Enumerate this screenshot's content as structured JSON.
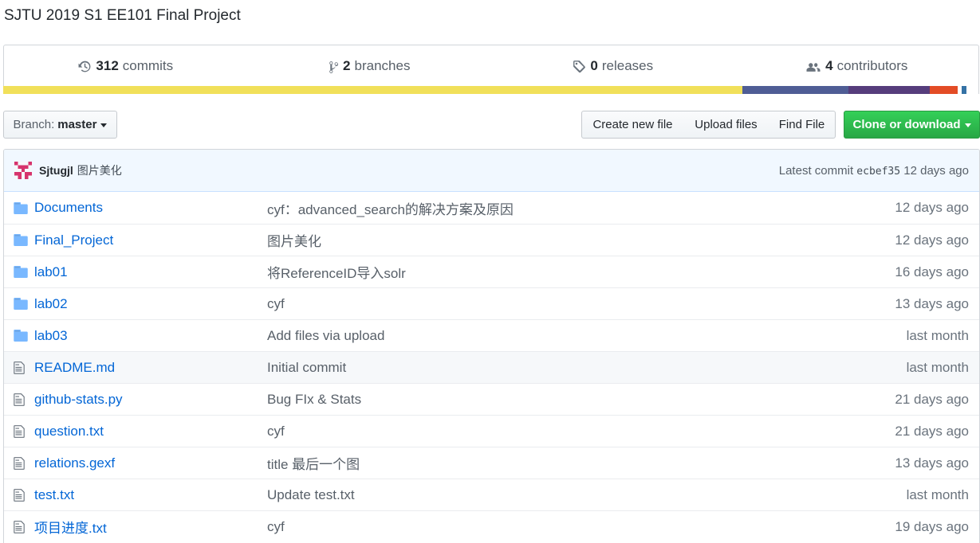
{
  "repo": {
    "description": "SJTU 2019 S1 EE101 Final Project"
  },
  "stats": {
    "commits": {
      "count": "312",
      "label": "commits",
      "icon": "history-icon"
    },
    "branches": {
      "count": "2",
      "label": "branches",
      "icon": "git-branch-icon"
    },
    "releases": {
      "count": "0",
      "label": "releases",
      "icon": "tag-icon"
    },
    "contributors": {
      "count": "4",
      "label": "contributors",
      "icon": "people-icon"
    }
  },
  "language_bar": [
    {
      "color": "#f1e05a",
      "share": 0.757
    },
    {
      "color": "#4f5d95",
      "share": 0.109
    },
    {
      "color": "#563d7c",
      "share": 0.083
    },
    {
      "color": "#e34c26",
      "share": 0.029
    },
    {
      "color": "#ffffff",
      "share": 0.004
    },
    {
      "color": "#3572a5",
      "share": 0.005
    }
  ],
  "toolbar": {
    "branch_label": "Branch:",
    "branch_value": "master",
    "create_new_file": "Create new file",
    "upload_files": "Upload files",
    "find_file": "Find File",
    "clone_or_download": "Clone or download"
  },
  "latest_commit": {
    "author": "Sjtugjl",
    "message": "图片美化",
    "prefix": "Latest commit",
    "sha": "ecbef35",
    "age": "12 days ago"
  },
  "files": [
    {
      "type": "dir",
      "name": "Documents",
      "message": "cyf：advanced_search的解决方案及原因",
      "age": "12 days ago"
    },
    {
      "type": "dir",
      "name": "Final_Project",
      "message": "图片美化",
      "age": "12 days ago"
    },
    {
      "type": "dir",
      "name": "lab01",
      "message": "将ReferenceID导入solr",
      "age": "16 days ago"
    },
    {
      "type": "dir",
      "name": "lab02",
      "message": "cyf",
      "age": "13 days ago"
    },
    {
      "type": "dir",
      "name": "lab03",
      "message": "Add files via upload",
      "age": "last month"
    },
    {
      "type": "file",
      "name": "README.md",
      "message": "Initial commit",
      "age": "last month"
    },
    {
      "type": "file",
      "name": "github-stats.py",
      "message": "Bug FIx & Stats",
      "age": "21 days ago"
    },
    {
      "type": "file",
      "name": "question.txt",
      "message": "cyf",
      "age": "21 days ago"
    },
    {
      "type": "file",
      "name": "relations.gexf",
      "message": "title 最后一个图",
      "age": "13 days ago"
    },
    {
      "type": "file",
      "name": "test.txt",
      "message": "Update test.txt",
      "age": "last month"
    },
    {
      "type": "file",
      "name": "项目进度.txt",
      "message": "cyf",
      "age": "19 days ago"
    }
  ],
  "colors": {
    "link": "#0366d6",
    "folder_icon": "#79b8ff",
    "file_icon": "#6a737d",
    "clone_button": "#28a745"
  }
}
